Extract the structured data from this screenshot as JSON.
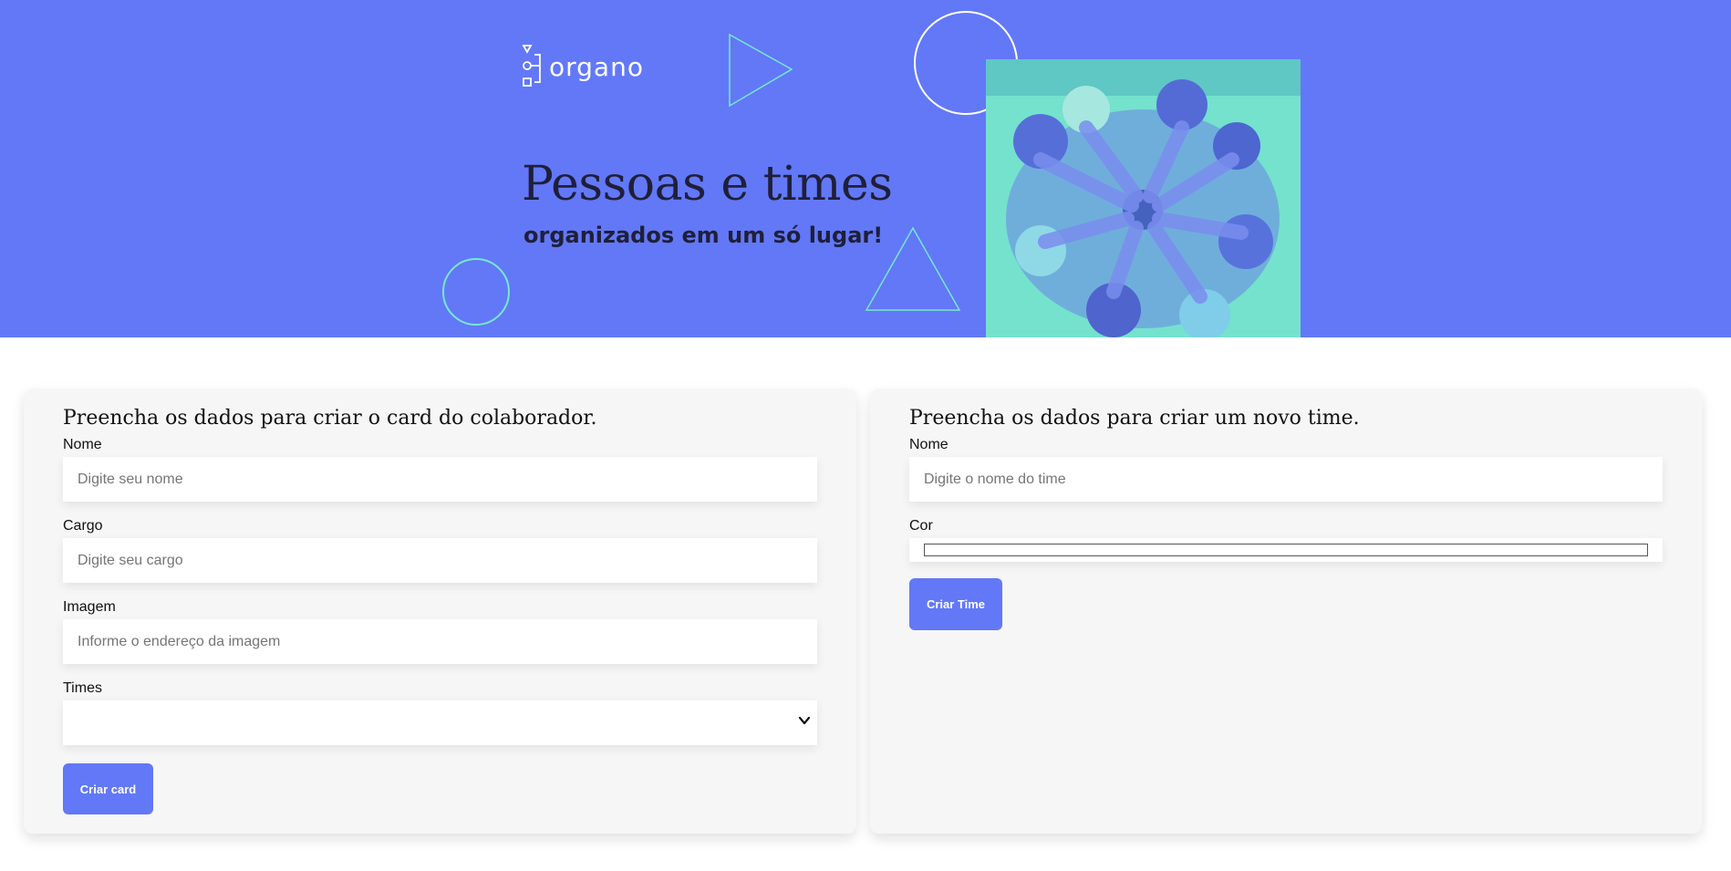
{
  "colors": {
    "primary": "#6278f7",
    "accent": "#76e8cf",
    "card_bg": "#f6f6f6"
  },
  "header": {
    "logo_text": "organo",
    "title": "Pessoas e times",
    "subtitle": "organizados em um só lugar!"
  },
  "colaborador_form": {
    "title": "Preencha os dados para criar o card do colaborador.",
    "nome": {
      "label": "Nome",
      "placeholder": "Digite seu nome",
      "value": ""
    },
    "cargo": {
      "label": "Cargo",
      "placeholder": "Digite seu cargo",
      "value": ""
    },
    "imagem": {
      "label": "Imagem",
      "placeholder": "Informe o endereço da imagem",
      "value": ""
    },
    "times": {
      "label": "Times",
      "selected": ""
    },
    "submit_label": "Criar card"
  },
  "time_form": {
    "title": "Preencha os dados para criar um novo time.",
    "nome": {
      "label": "Nome",
      "placeholder": "Digite o nome do time",
      "value": ""
    },
    "cor": {
      "label": "Cor",
      "value": "#ffffff"
    },
    "submit_label": "Criar Time"
  },
  "icons": [
    "organo-logo-icon",
    "chevron-down-icon"
  ]
}
